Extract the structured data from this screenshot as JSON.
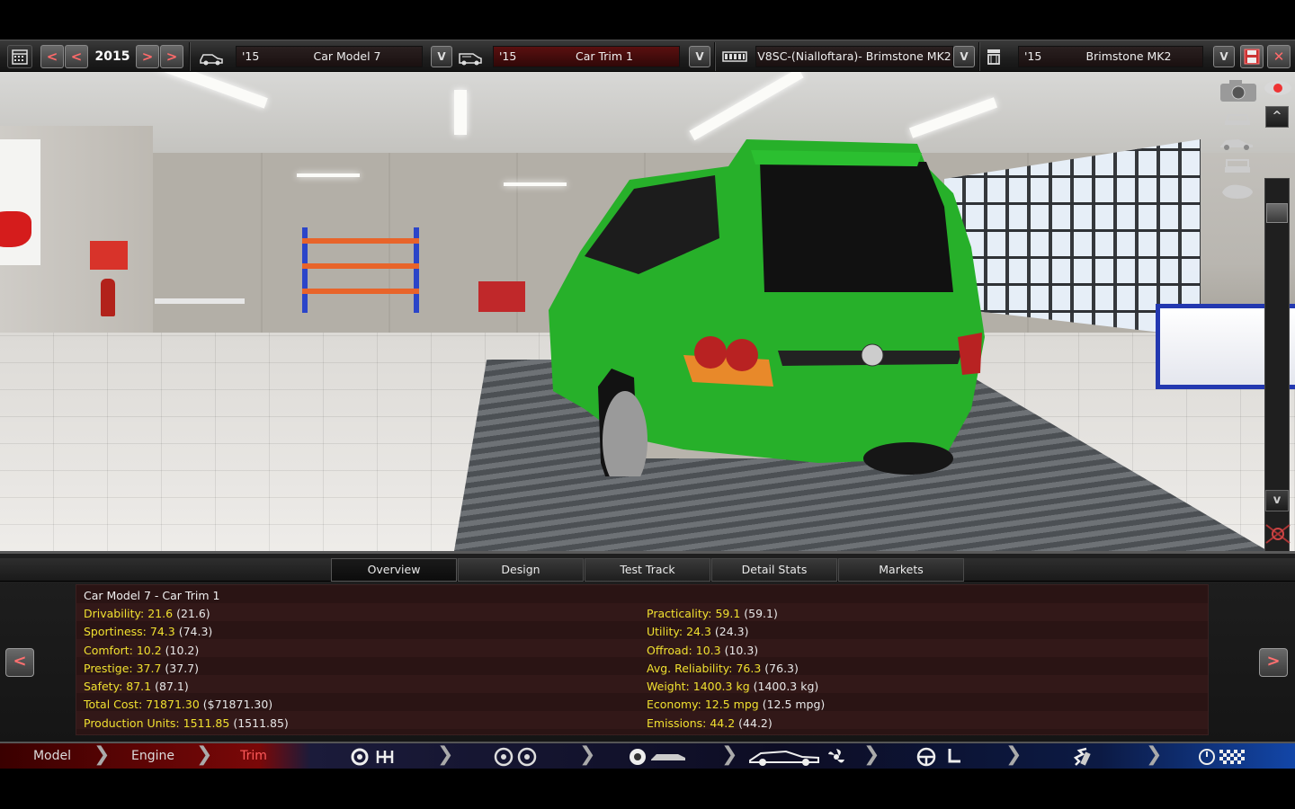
{
  "toolbar": {
    "year": "2015",
    "model": {
      "year": "'15",
      "name": "Car Model 7"
    },
    "trim": {
      "year": "'15",
      "name": "Car Trim 1"
    },
    "engine": {
      "year": "",
      "name": "V8SC-(Nialloftara)- Brimstone MK2"
    },
    "family": {
      "year": "'15",
      "name": "Brimstone MK2"
    },
    "icons": [
      "calendar-icon",
      "car-model-icon",
      "car-trim-icon",
      "engine-icon",
      "engine-family-icon",
      "save-icon",
      "close-icon"
    ]
  },
  "viewport": {
    "scroll_up": "^",
    "scroll_down": "v",
    "view_icons": [
      "camera-icon",
      "eye-icon",
      "car-front-icon",
      "car-side-icon",
      "car-rear-icon",
      "car-top-icon",
      "reset-view-icon"
    ]
  },
  "tabs": [
    {
      "label": "Overview"
    },
    {
      "label": "Design"
    },
    {
      "label": "Test Track"
    },
    {
      "label": "Detail Stats"
    },
    {
      "label": "Markets"
    }
  ],
  "overview": {
    "title": "Car Model 7 - Car Trim 1",
    "left": [
      {
        "key": "Drivability:",
        "value": "21.6",
        "paren": "(21.6)"
      },
      {
        "key": "Sportiness:",
        "value": "74.3",
        "paren": "(74.3)"
      },
      {
        "key": "Comfort:",
        "value": "10.2",
        "paren": "(10.2)"
      },
      {
        "key": "Prestige:",
        "value": "37.7",
        "paren": "(37.7)"
      },
      {
        "key": "Safety:",
        "value": "87.1",
        "paren": "(87.1)"
      },
      {
        "key": "Total Cost:",
        "value": "71871.30",
        "paren": "($71871.30)"
      },
      {
        "key": "Production Units:",
        "value": "1511.85",
        "paren": "(1511.85)"
      }
    ],
    "right": [
      {
        "key": "Practicality:",
        "value": "59.1",
        "paren": "(59.1)"
      },
      {
        "key": "Utility:",
        "value": "24.3",
        "paren": "(24.3)"
      },
      {
        "key": "Offroad:",
        "value": "10.3",
        "paren": "(10.3)"
      },
      {
        "key": "Avg. Reliability:",
        "value": "76.3",
        "paren": "(76.3)"
      },
      {
        "key": "Weight:",
        "value": "1400.3 kg",
        "paren": "(1400.3 kg)"
      },
      {
        "key": "Economy:",
        "value": "12.5 mpg",
        "paren": "(12.5 mpg)"
      },
      {
        "key": "Emissions:",
        "value": "44.2",
        "paren": "(44.2)"
      }
    ],
    "prev": "<",
    "next": ">"
  },
  "nav": {
    "items": [
      {
        "label": "Model"
      },
      {
        "label": "Engine"
      },
      {
        "label": "Trim"
      }
    ]
  },
  "colors": {
    "stat_yellow": "#f0e030",
    "trim_red": "#ff5a5a",
    "panel_bg": "#2a1414"
  }
}
